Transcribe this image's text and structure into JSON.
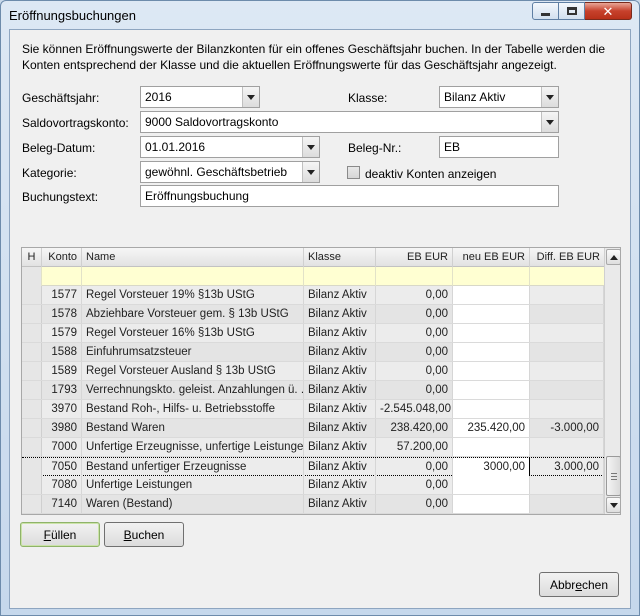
{
  "window": {
    "title": "Eröffnungsbuchungen",
    "close_glyph": "✕"
  },
  "intro": "Sie können Eröffnungswerte der Bilanzkonten für ein offenes Geschäftsjahr buchen. In der Tabelle werden die Konten entsprechend der Klasse und die aktuellen Eröffnungswerte für das Geschäftsjahr angezeigt.",
  "form": {
    "geschaeftsjahr_label": "Geschäftsjahr:",
    "geschaeftsjahr_value": "2016",
    "klasse_label": "Klasse:",
    "klasse_value": "Bilanz Aktiv",
    "saldovortragskonto_label": "Saldovortragskonto:",
    "saldovortragskonto_value": "9000 Saldovortragskonto",
    "belegdatum_label": "Beleg-Datum:",
    "belegdatum_value": "01.01.2016",
    "belegnr_label": "Beleg-Nr.:",
    "belegnr_value": "EB",
    "kategorie_label": "Kategorie:",
    "kategorie_value": "gewöhnl. Geschäftsbetrieb",
    "deaktiv_label": "deaktiv Konten anzeigen",
    "buchungstext_label": "Buchungstext:",
    "buchungstext_value": "Eröffnungsbuchung"
  },
  "grid": {
    "indicator_header": "H",
    "columns": [
      "Konto",
      "Name",
      "Klasse",
      "EB EUR",
      "neu EB EUR",
      "Diff. EB EUR"
    ],
    "rows": [
      {
        "konto": "1577",
        "name": "Regel Vorsteuer 19% §13b UStG",
        "klasse": "Bilanz Aktiv",
        "eb": "0,00",
        "neu": "",
        "diff": ""
      },
      {
        "konto": "1578",
        "name": "Abziehbare Vorsteuer gem. § 13b UStG",
        "klasse": "Bilanz Aktiv",
        "eb": "0,00",
        "neu": "",
        "diff": ""
      },
      {
        "konto": "1579",
        "name": "Regel Vorsteuer 16% §13b UStG",
        "klasse": "Bilanz Aktiv",
        "eb": "0,00",
        "neu": "",
        "diff": ""
      },
      {
        "konto": "1588",
        "name": "Einfuhrumsatzsteuer",
        "klasse": "Bilanz Aktiv",
        "eb": "0,00",
        "neu": "",
        "diff": ""
      },
      {
        "konto": "1589",
        "name": "Regel Vorsteuer Ausland § 13b UStG",
        "klasse": "Bilanz Aktiv",
        "eb": "0,00",
        "neu": "",
        "diff": ""
      },
      {
        "konto": "1793",
        "name": "Verrechnungskto. geleist. Anzahlungen ü. ...",
        "klasse": "Bilanz Aktiv",
        "eb": "0,00",
        "neu": "",
        "diff": ""
      },
      {
        "konto": "3970",
        "name": "Bestand Roh-, Hilfs- u. Betriebsstoffe",
        "klasse": "Bilanz Aktiv",
        "eb": "-2.545.048,00",
        "neu": "",
        "diff": ""
      },
      {
        "konto": "3980",
        "name": "Bestand Waren",
        "klasse": "Bilanz Aktiv",
        "eb": "238.420,00",
        "neu": "235.420,00",
        "diff": "-3.000,00"
      },
      {
        "konto": "7000",
        "name": "Unfertige Erzeugnisse, unfertige Leistungen",
        "klasse": "Bilanz Aktiv",
        "eb": "57.200,00",
        "neu": "",
        "diff": ""
      },
      {
        "konto": "7050",
        "name": "Bestand unfertiger Erzeugnisse",
        "klasse": "Bilanz Aktiv",
        "eb": "0,00",
        "neu": "3000,00",
        "diff": "3.000,00"
      },
      {
        "konto": "7080",
        "name": "Unfertige Leistungen",
        "klasse": "Bilanz Aktiv",
        "eb": "0,00",
        "neu": "",
        "diff": ""
      },
      {
        "konto": "7140",
        "name": "Waren (Bestand)",
        "klasse": "Bilanz Aktiv",
        "eb": "0,00",
        "neu": "",
        "diff": ""
      }
    ]
  },
  "buttons": {
    "fuellen_key": "F",
    "fuellen_rest": "üllen",
    "buchen_key": "B",
    "buchen_rest": "uchen",
    "abbrechen_pre": "Abbr",
    "abbrechen_key": "e",
    "abbrechen_rest": "chen"
  }
}
